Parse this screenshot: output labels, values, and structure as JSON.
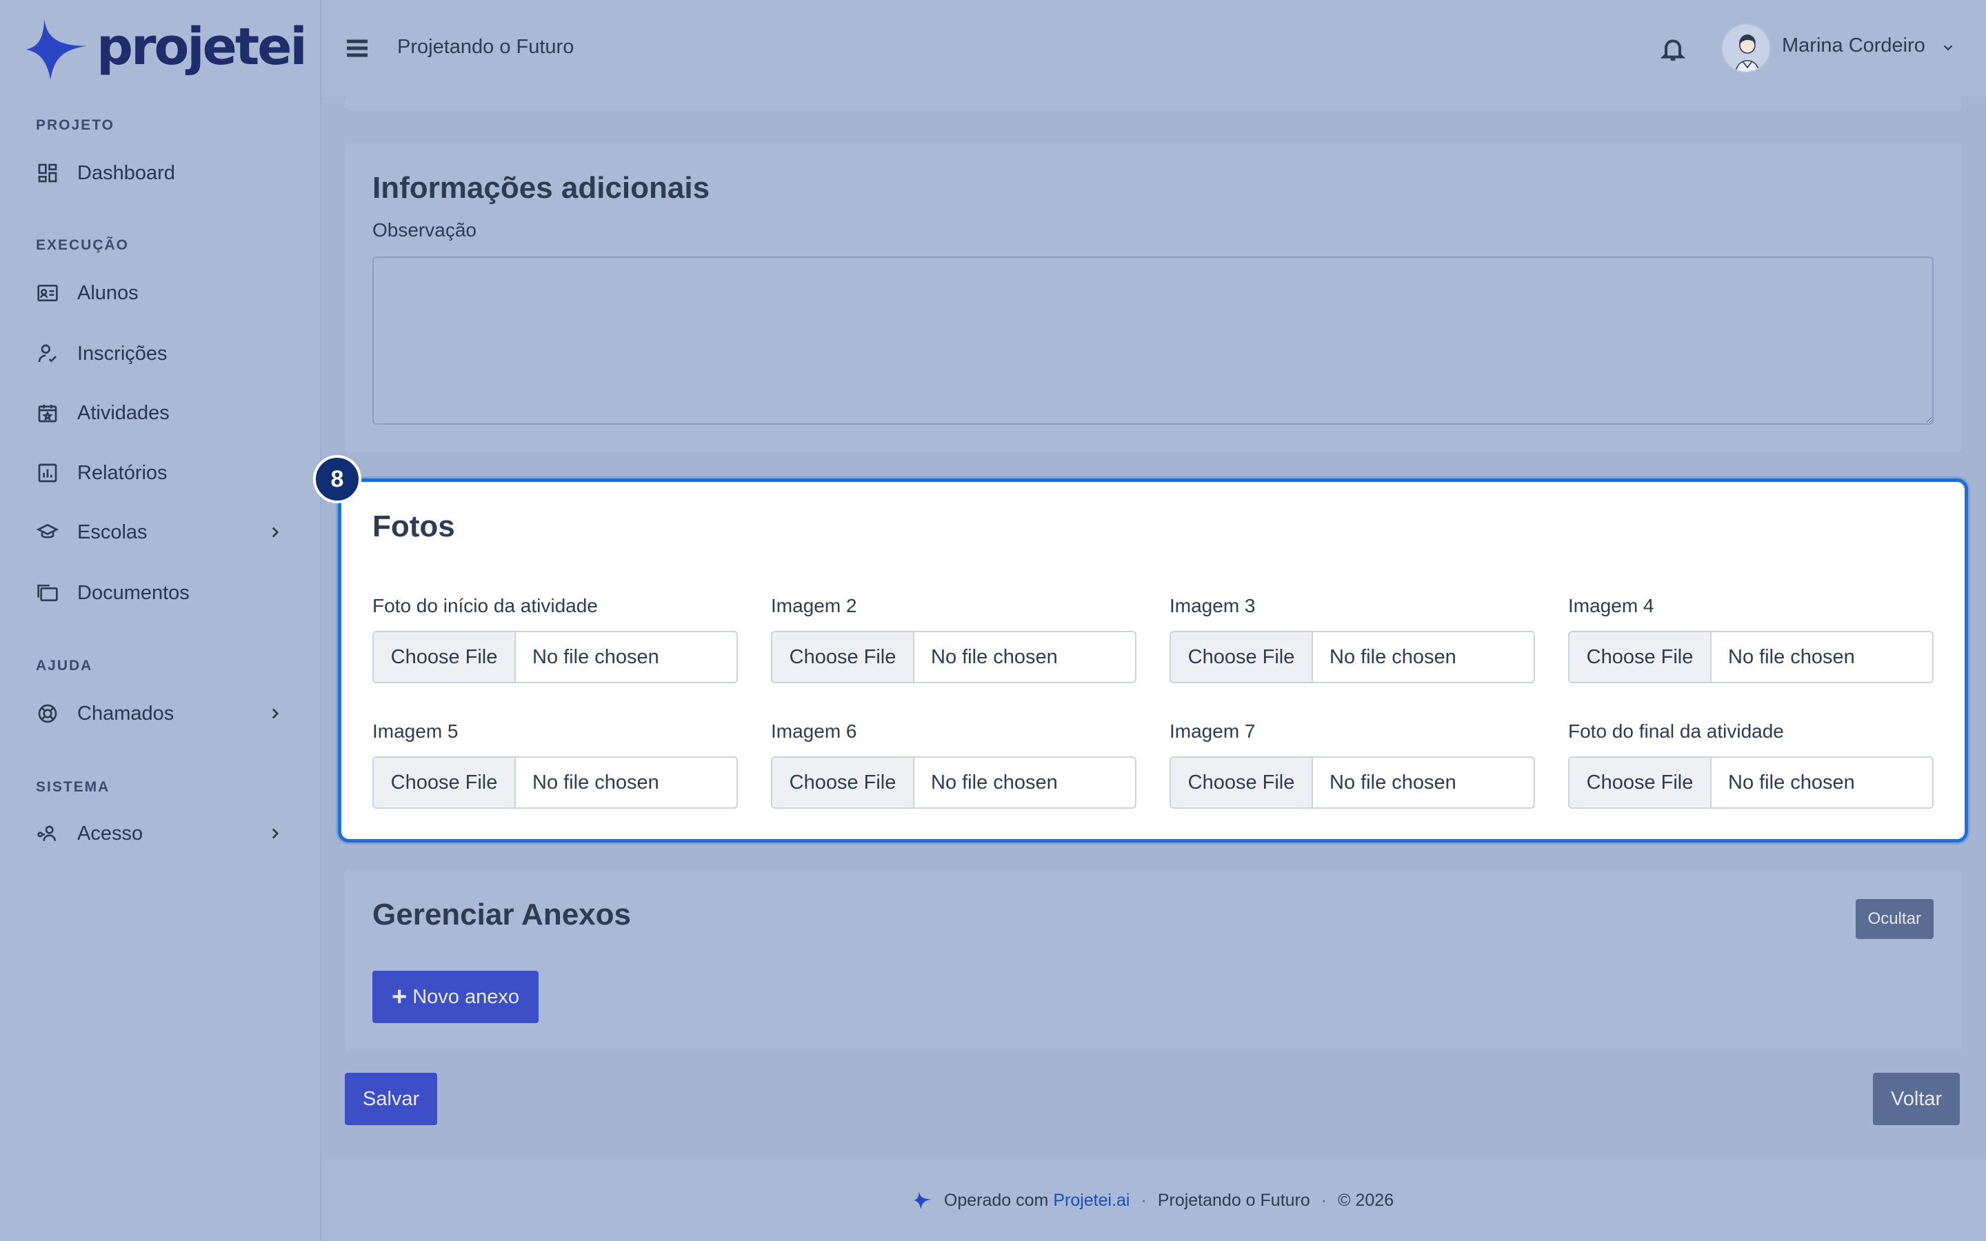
{
  "brand": {
    "name": "projetei",
    "accent": "#2b46c4"
  },
  "header": {
    "project_title": "Projetando o Futuro",
    "user_name": "Marina Cordeiro"
  },
  "sidebar": {
    "sections": [
      {
        "label": "PROJETO"
      },
      {
        "label": "EXECUÇÃO"
      },
      {
        "label": "AJUDA"
      },
      {
        "label": "SISTEMA"
      }
    ],
    "items": [
      {
        "label": "Dashboard",
        "icon": "grid-icon"
      },
      {
        "label": "Alunos",
        "icon": "id-card-icon"
      },
      {
        "label": "Inscrições",
        "icon": "user-check-icon"
      },
      {
        "label": "Atividades",
        "icon": "calendar-star-icon"
      },
      {
        "label": "Relatórios",
        "icon": "bar-chart-icon"
      },
      {
        "label": "Escolas",
        "icon": "school-icon"
      },
      {
        "label": "Documentos",
        "icon": "folders-icon"
      },
      {
        "label": "Chamados",
        "icon": "lifebuoy-icon"
      },
      {
        "label": "Acesso",
        "icon": "user-key-icon"
      }
    ]
  },
  "info": {
    "title": "Informações adicionais",
    "obs_label": "Observação",
    "obs_value": ""
  },
  "fotos": {
    "badge": "8",
    "title": "Fotos",
    "choose_label": "Choose File",
    "status": "No file chosen",
    "fields": [
      {
        "label": "Foto do início da atividade"
      },
      {
        "label": "Imagem 2"
      },
      {
        "label": "Imagem 3"
      },
      {
        "label": "Imagem 4"
      },
      {
        "label": "Imagem 5"
      },
      {
        "label": "Imagem 6"
      },
      {
        "label": "Imagem 7"
      },
      {
        "label": "Foto do final da atividade"
      }
    ]
  },
  "anexos": {
    "title": "Gerenciar Anexos",
    "hide_label": "Ocultar",
    "new_label": "Novo anexo"
  },
  "actions": {
    "save_label": "Salvar",
    "back_label": "Voltar"
  },
  "footer": {
    "operated_by": "Operado com",
    "link": "Projetei.ai",
    "project": "Projetando o Futuro",
    "copyright": "© 2026"
  }
}
